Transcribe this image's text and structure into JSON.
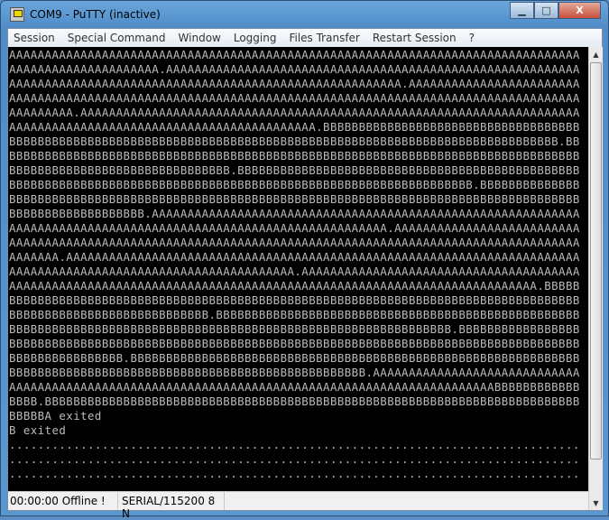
{
  "window": {
    "title": "COM9 - PuTTY (inactive)",
    "minimize": "▁",
    "maximize": "□",
    "close": "X"
  },
  "menu": [
    "Session",
    "Special Command",
    "Window",
    "Logging",
    "Files Transfer",
    "Restart Session",
    "?"
  ],
  "terminal": {
    "lines": [
      "AAAAAAAAAAAAAAAAAAAAAAAAAAAAAAAAAAAAAAAAAAAAAAAAAAAAAAAAAAAAAAAAAAAAAAAAAAAAAAAA",
      "AAAAAAAAAAAAAAAAAAAAA.AAAAAAAAAAAAAAAAAAAAAAAAAAAAAAAAAAAAAAAAAAAAAAAAAAAAAAAAAA",
      "AAAAAAAAAAAAAAAAAAAAAAAAAAAAAAAAAAAAAAAAAAAAAAAAAAAAAAA.AAAAAAAAAAAAAAAAAAAAAAAA",
      "AAAAAAAAAAAAAAAAAAAAAAAAAAAAAAAAAAAAAAAAAAAAAAAAAAAAAAAAAAAAAAAAAAAAAAAAAAAAAAAA",
      "AAAAAAAAA.AAAAAAAAAAAAAAAAAAAAAAAAAAAAAAAAAAAAAAAAAAAAAAAAAAAAAAAAAAAAAAAAAAAAAA",
      "AAAAAAAAAAAAAAAAAAAAAAAAAAAAAAAAAAAAAAAAAAA.BBBBBBBBBBBBBBBBBBBBBBBBBBBBBBBBBBBB",
      "BBBBBBBBBBBBBBBBBBBBBBBBBBBBBBBBBBBBBBBBBBBBBBBBBBBBBBBBBBBBBBBBBBBBBBBBBBBBB.BB",
      "BBBBBBBBBBBBBBBBBBBBBBBBBBBBBBBBBBBBBBBBBBBBBBBBBBBBBBBBBBBBBBBBBBBBBBBBBBBBBBBB",
      "BBBBBBBBBBBBBBBBBBBBBBBBBBBBBBB.BBBBBBBBBBBBBBBBBBBBBBBBBBBBBBBBBBBBBBBBBBBBBBBB",
      "BBBBBBBBBBBBBBBBBBBBBBBBBBBBBBBBBBBBBBBBBBBBBBBBBBBBBBBBBBBBBBBBB.BBBBBBBBBBBBBB",
      "BBBBBBBBBBBBBBBBBBBBBBBBBBBBBBBBBBBBBBBBBBBBBBBBBBBBBBBBBBBBBBBBBBBBBBBBBBBBBBBB",
      "BBBBBBBBBBBBBBBBBBB.AAAAAAAAAAAAAAAAAAAAAAAAAAAAAAAAAAAAAAAAAAAAAAAAAAAAAAAAAAAA",
      "AAAAAAAAAAAAAAAAAAAAAAAAAAAAAAAAAAAAAAAAAAAAAAAAAAAAA.AAAAAAAAAAAAAAAAAAAAAAAAAA",
      "AAAAAAAAAAAAAAAAAAAAAAAAAAAAAAAAAAAAAAAAAAAAAAAAAAAAAAAAAAAAAAAAAAAAAAAAAAAAAAAA",
      "AAAAAAA.AAAAAAAAAAAAAAAAAAAAAAAAAAAAAAAAAAAAAAAAAAAAAAAAAAAAAAAAAAAAAAAAAAAAAAAA",
      "AAAAAAAAAAAAAAAAAAAAAAAAAAAAAAAAAAAAAAAA.AAAAAAAAAAAAAAAAAAAAAAAAAAAAAAAAAAAAAAA",
      "AAAAAAAAAAAAAAAAAAAAAAAAAAAAAAAAAAAAAAAAAAAAAAAAAAAAAAAAAAAAAAAAAAAAAAAAAA.BBBBB",
      "BBBBBBBBBBBBBBBBBBBBBBBBBBBBBBBBBBBBBBBBBBBBBBBBBBBBBBBBBBBBBBBBBBBBBBBBBBBBBBBB",
      "BBBBBBBBBBBBBBBBBBBBBBBBBBBB.BBBBBBBBBBBBBBBBBBBBBBBBBBBBBBBBBBBBBBBBBBBBBBBBBBB",
      "BBBBBBBBBBBBBBBBBBBBBBBBBBBBBBBBBBBBBBBBBBBBBBBBBBBBBBBBBBBBBB.BBBBBBBBBBBBBBBBB",
      "BBBBBBBBBBBBBBBBBBBBBBBBBBBBBBBBBBBBBBBBBBBBBBBBBBBBBBBBBBBBBBBBBBBBBBBBBBBBBBBB",
      "BBBBBBBBBBBBBBBB.BBBBBBBBBBBBBBBBBBBBBBBBBBBBBBBBBBBBBBBBBBBBBBBBBBBBBBBBBBBBBBB",
      "BBBBBBBBBBBBBBBBBBBBBBBBBBBBBBBBBBBBBBBBBBBBBBBBBB.AAAAAAAAAAAAAAAAAAAAAAAAAAAAA",
      "AAAAAAAAAAAAAAAAAAAAAAAAAAAAAAAAAAAAAAAAAAAAAAAAAAAAAAAAAAAAAAAAAAAABBBBBBBBBBBB",
      "BBBB.BBBBBBBBBBBBBBBBBBBBBBBBBBBBBBBBBBBBBBBBBBBBBBBBBBBBBBBBBBBBBBBBBBBBBBBBBBB",
      "BBBBBA exited",
      "B exited",
      "................................................................................",
      "................................................................................",
      "................................................................................"
    ],
    "text_color": "#bbbbbb",
    "background": "#000000"
  },
  "status": {
    "time": "00:00:00 Offline !",
    "connection": "SERIAL/115200 8 N"
  }
}
